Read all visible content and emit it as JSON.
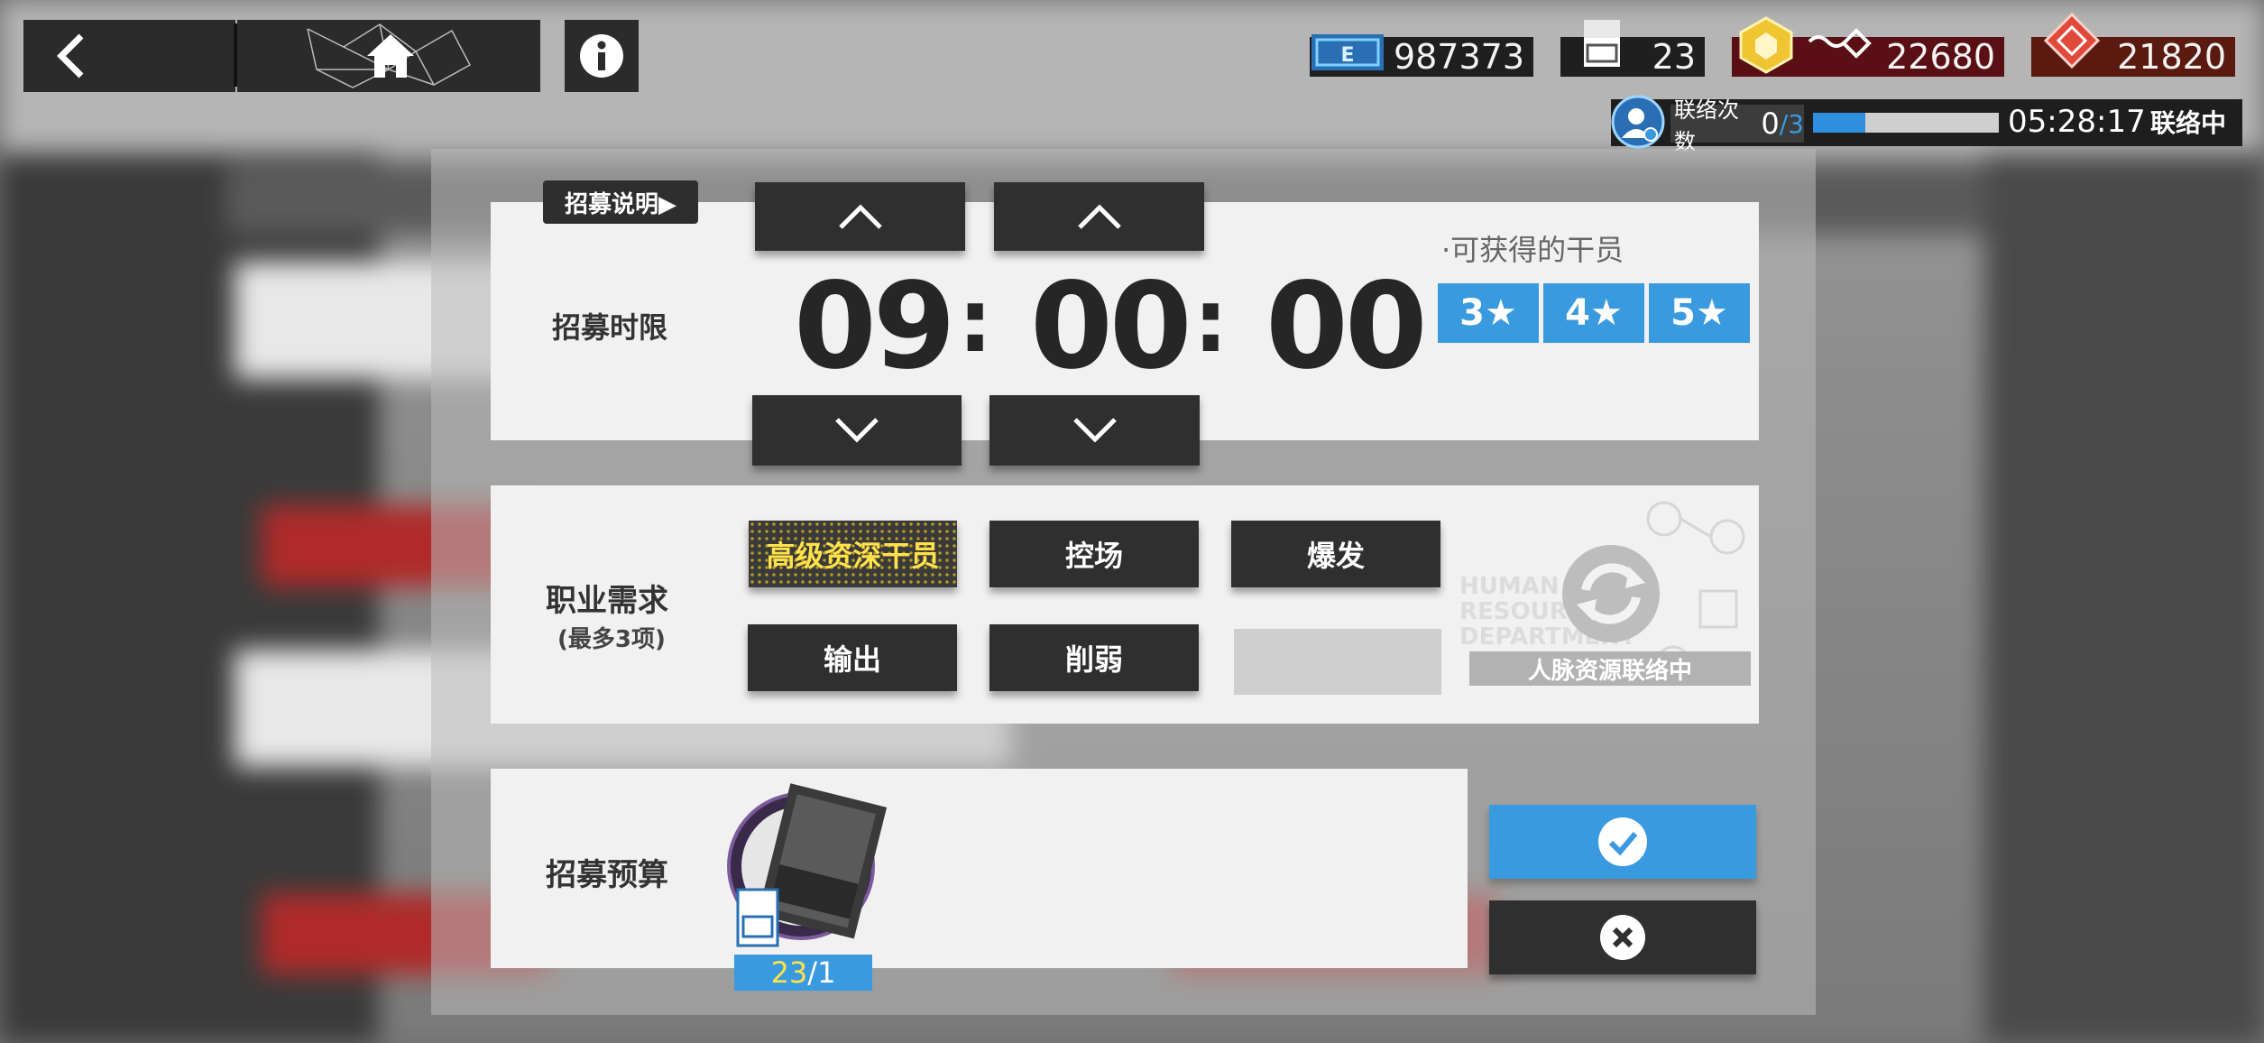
{
  "top_bar": {
    "resources": [
      {
        "name": "lmd-icon",
        "value": "987373"
      },
      {
        "name": "recruit-permit-icon",
        "value": "23"
      },
      {
        "name": "originium-icon",
        "value": "22680"
      },
      {
        "name": "orundum-icon",
        "value": "21820"
      }
    ],
    "contact": {
      "label": "联络次数",
      "count": "0",
      "max": "/3",
      "timer": "05:28:17",
      "status": "联络中",
      "progress": 0.28
    }
  },
  "recruit": {
    "help_label": "招募说明▶",
    "time_limit_label": "招募时限",
    "hours": "09",
    "minutes": "00",
    "seconds": "00",
    "colon": ":",
    "obtainable_label": "·可获得的干员",
    "stars": [
      "3★",
      "4★",
      "5★"
    ],
    "profession_label": "职业需求",
    "profession_sub": "(最多3项)",
    "tags": [
      "高级资深干员",
      "控场",
      "爆发",
      "输出",
      "削弱"
    ],
    "selected_tag": "高级资深干员",
    "hr_label": "人脉资源联络中",
    "hr_watermark": "HUMAN RESOURCES DEPARTMENT",
    "budget_label": "招募预算",
    "permit_count": "23",
    "permit_cost": "/1"
  },
  "colors": {
    "accent_blue": "#3a9ae0",
    "selected_tag_text": "#ffe14a",
    "dark_button": "#2f2f2f"
  }
}
